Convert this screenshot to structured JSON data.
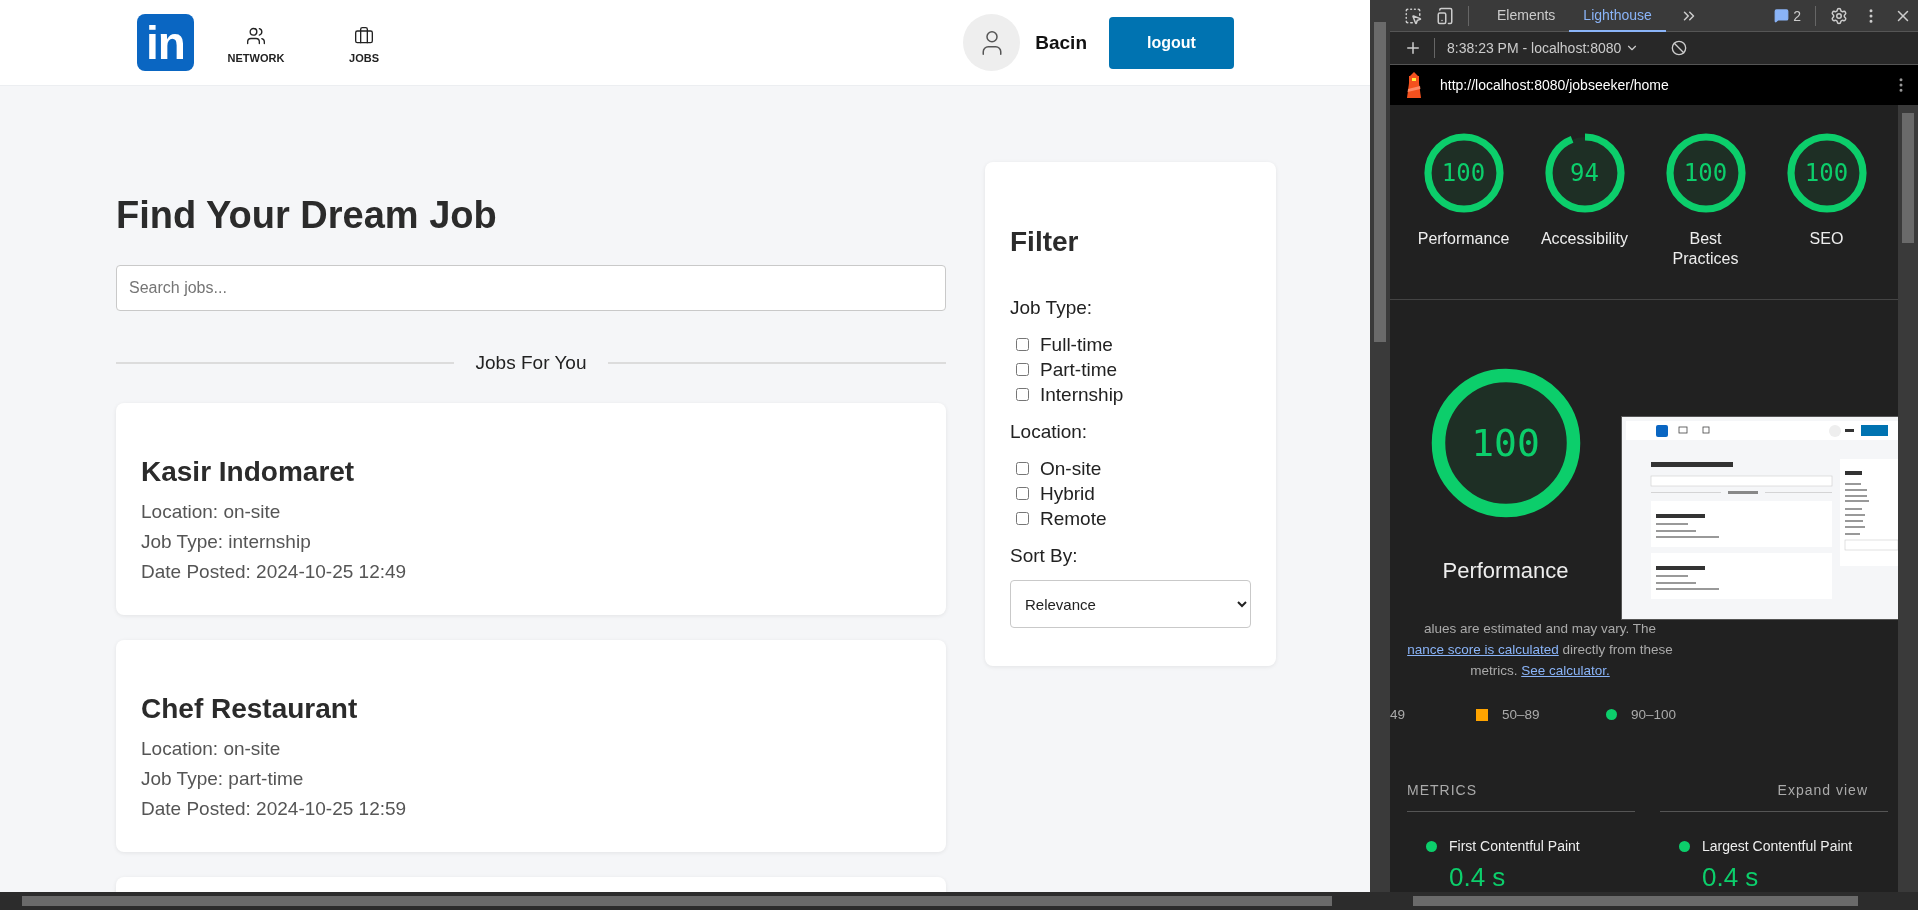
{
  "page": {
    "header": {
      "logo_text": "in",
      "nav": [
        {
          "kind": "people",
          "label": "NETWORK"
        },
        {
          "kind": "briefcase",
          "label": "JOBS"
        }
      ],
      "user_name": "Bacin",
      "logout_label": "logout"
    },
    "title": "Find Your Dream Job",
    "search_placeholder": "Search jobs...",
    "section_label": "Jobs For You",
    "jobs": [
      {
        "title": "Kasir Indomaret",
        "lines": [
          "Location: on-site",
          "Job Type: internship",
          "Date Posted: 2024-10-25 12:49"
        ]
      },
      {
        "title": "Chef Restaurant",
        "lines": [
          "Location: on-site",
          "Job Type: part-time",
          "Date Posted: 2024-10-25 12:59"
        ]
      }
    ],
    "filter": {
      "title": "Filter",
      "groups": [
        {
          "label": "Job Type:",
          "options": [
            {
              "label": "Full-time",
              "checked": false
            },
            {
              "label": "Part-time",
              "checked": false
            },
            {
              "label": "Internship",
              "checked": false
            }
          ]
        },
        {
          "label": "Location:",
          "options": [
            {
              "label": "On-site",
              "checked": false
            },
            {
              "label": "Hybrid",
              "checked": false
            },
            {
              "label": "Remote",
              "checked": false
            }
          ]
        }
      ],
      "sort_label": "Sort By:",
      "sort_value": "Relevance"
    }
  },
  "devtools": {
    "tabs": [
      {
        "label": "Elements",
        "selected": false
      },
      {
        "label": "Lighthouse",
        "selected": true
      }
    ],
    "issues_count": "2",
    "report_label": "8:38:23 PM - localhost:8080",
    "url": "http://localhost:8080/jobseeker/home",
    "scores": [
      {
        "value": "100",
        "label": "Performance"
      },
      {
        "value": "94",
        "label": "Accessibility"
      },
      {
        "value": "100",
        "label": "Best Practices"
      },
      {
        "value": "100",
        "label": "SEO"
      }
    ],
    "performance": {
      "value": "100",
      "label": "Performance"
    },
    "note": {
      "line_1": "alues are estimated and may vary. The",
      "link_1": "nance score is calculated",
      "text_2": " directly from these",
      "text_3": "metrics.",
      "link_2": "See calculator."
    },
    "legend": [
      {
        "kind": "none",
        "label": "49"
      },
      {
        "kind": "square",
        "color": "#ffa400",
        "label": "50–89"
      },
      {
        "kind": "dot",
        "color": "#0cce6b",
        "label": "90–100"
      }
    ],
    "metrics_title": "METRICS",
    "expand_label": "Expand view",
    "metrics": [
      {
        "label": "First Contentful Paint",
        "value": "0.4 s",
        "color": "#0cce6b"
      },
      {
        "label": "Largest Contentful Paint",
        "value": "0.4 s",
        "color": "#0cce6b"
      }
    ]
  }
}
